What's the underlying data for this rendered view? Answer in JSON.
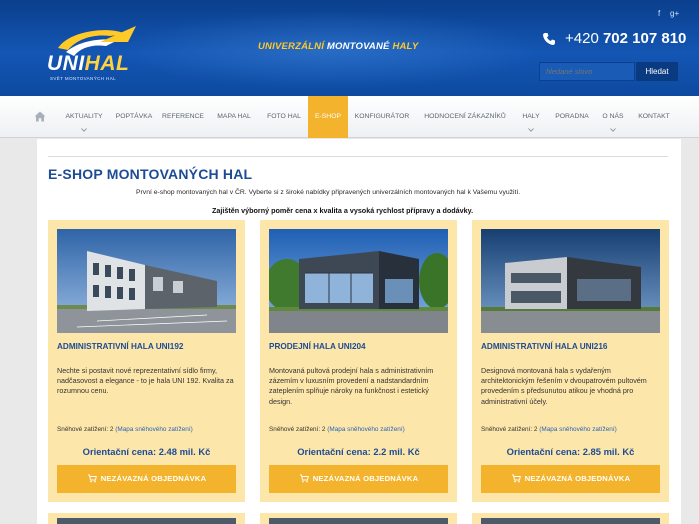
{
  "header": {
    "logo_main": "UNI",
    "logo_accent": "HAL",
    "logo_sub": "SVĚT MONTOVANÝCH HAL",
    "tagline_part1": "UNIVERZÁLNÍ",
    "tagline_part2": "MONTOVANÉ",
    "tagline_part3": "HALY",
    "social_facebook": "f",
    "social_gplus": "g+",
    "phone_prefix": "+420",
    "phone_number": "702 107 810",
    "search_placeholder": "hledané slovo",
    "search_button": "Hledat"
  },
  "nav": {
    "items": [
      {
        "label": "AKTUALITY"
      },
      {
        "label": "POPTÁVKA"
      },
      {
        "label": "REFERENCE"
      },
      {
        "label": "MAPA HAL"
      },
      {
        "label": "FOTO HAL"
      },
      {
        "label": "E-SHOP"
      },
      {
        "label": "KONFIGURÁTOR"
      },
      {
        "label": "HODNOCENÍ ZÁKAZNÍKŮ"
      },
      {
        "label": "HALY"
      },
      {
        "label": "PORADNA"
      },
      {
        "label": "O NÁS"
      },
      {
        "label": "KONTAKT"
      }
    ],
    "active": "E-SHOP"
  },
  "page": {
    "title": "E-SHOP MONTOVANÝCH HAL",
    "intro": "První e-shop montovaných hal v ČR. Vyberte si z široké nabídky připravených univerzálních montovaných hal k Vašemu využití.",
    "intro_bold": "Zajištěn výborný poměr cena x kvalita a vysoká rychlost přípravy a dodávky."
  },
  "products": [
    {
      "title": "ADMINISTRATIVNÍ HALA UNI192",
      "description": "Nechte si postavit nové reprezentativní sídlo firmy, nadčasovost a elegance - to je hala UNI 192. Kvalita za rozumnou cenu.",
      "snow_label": "Sněhové zatížení: 2",
      "snow_link": "(Mapa sněhového zatížení)",
      "price": "Orientační cena: 2.48 mil. Kč",
      "button": "NEZÁVAZNÁ OBJEDNÁVKA"
    },
    {
      "title": "PRODEJNÍ HALA UNI204",
      "description": "Montovaná pultová prodejní hala s administrativním zázemím v luxusním provedení a nadstandardním zateplením splňuje nároky na funkčnost i estetický design.",
      "snow_label": "Sněhové zatížení: 2",
      "snow_link": "(Mapa sněhového zatížení)",
      "price": "Orientační cena: 2.2 mil. Kč",
      "button": "NEZÁVAZNÁ OBJEDNÁVKA"
    },
    {
      "title": "ADMINISTRATIVNÍ HALA UNI216",
      "description": "Designová montovaná hala s vydařeným architektonickým řešením v dvoupatrovém pultovém provedením s předsunutou atikou je vhodná pro administrativní účely.",
      "snow_label": "Sněhové zatížení: 2",
      "snow_link": "(Mapa sněhového zatížení)",
      "price": "Orientační cena: 2.85 mil. Kč",
      "button": "NEZÁVAZNÁ OBJEDNÁVKA"
    }
  ],
  "colors": {
    "brand_blue": "#1d4c96",
    "accent_orange": "#f4b32c",
    "card_bg": "#fde6a9"
  }
}
